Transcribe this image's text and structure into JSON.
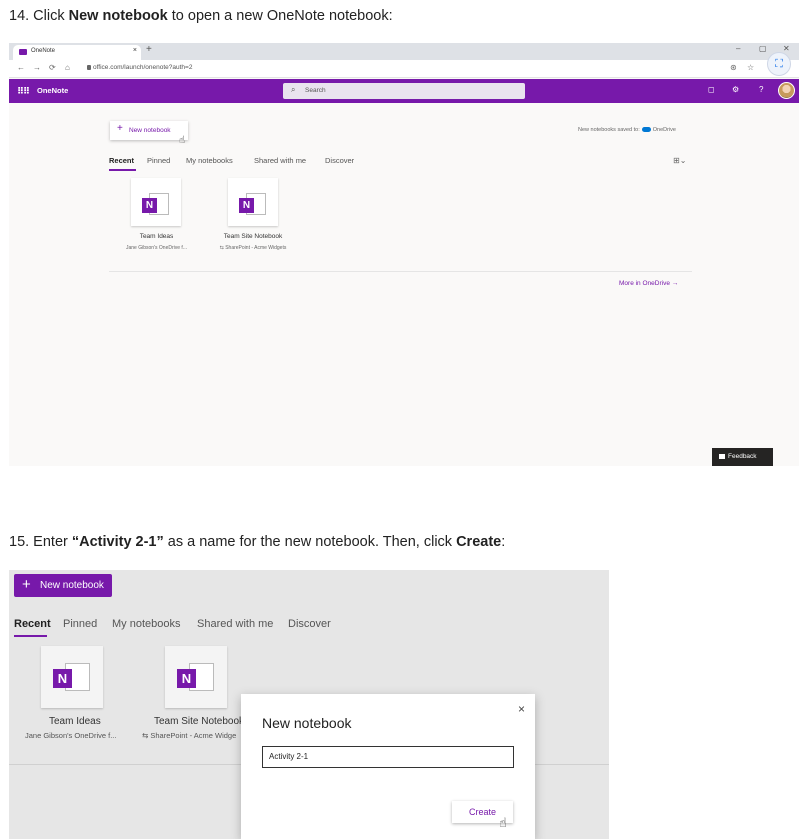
{
  "steps": {
    "step14": {
      "prefix": "14. Click ",
      "bold": "New notebook",
      "suffix": " to open a new OneNote notebook:"
    },
    "step15": {
      "prefix": "15. Enter ",
      "bold": "“Activity 2-1”",
      "middle": " as a name for the new notebook. Then, click ",
      "bold2": "Create",
      "suffix": ":"
    }
  },
  "shot1": {
    "browser": {
      "tab_title": "OneNote",
      "tab_close": "×",
      "new_tab": "+",
      "url": "office.com/launch/onenote?auth=2",
      "win_min": "–",
      "win_max": "▢",
      "win_close": "✕"
    },
    "app": {
      "name": "OneNote",
      "search_placeholder": "Search",
      "help": "?"
    },
    "new_notebook_label": "New notebook",
    "saved_text": "New notebooks saved to:",
    "saved_location": "OneDrive",
    "tabs": [
      "Recent",
      "Pinned",
      "My notebooks",
      "Shared with me",
      "Discover"
    ],
    "notebooks": [
      {
        "name": "Team Ideas",
        "location": "Jane Gibson's OneDrive f..."
      },
      {
        "name": "Team Site Notebook",
        "location": "SharePoint - Acme Widgets"
      }
    ],
    "more_link": "More in OneDrive →",
    "feedback": "Feedback"
  },
  "shot2": {
    "new_notebook_label": "New notebook",
    "tabs": [
      "Recent",
      "Pinned",
      "My notebooks",
      "Shared with me",
      "Discover"
    ],
    "notebooks": [
      {
        "name": "Team Ideas",
        "location": "Jane Gibson's OneDrive f..."
      },
      {
        "name": "Team Site Notebook",
        "location": "SharePoint - Acme Widge"
      }
    ],
    "dialog": {
      "title": "New notebook",
      "input_value": "Activity 2-1",
      "create_label": "Create",
      "close": "×"
    }
  },
  "colors": {
    "brand": "#7719aa",
    "feedback_bg": "#252423"
  }
}
